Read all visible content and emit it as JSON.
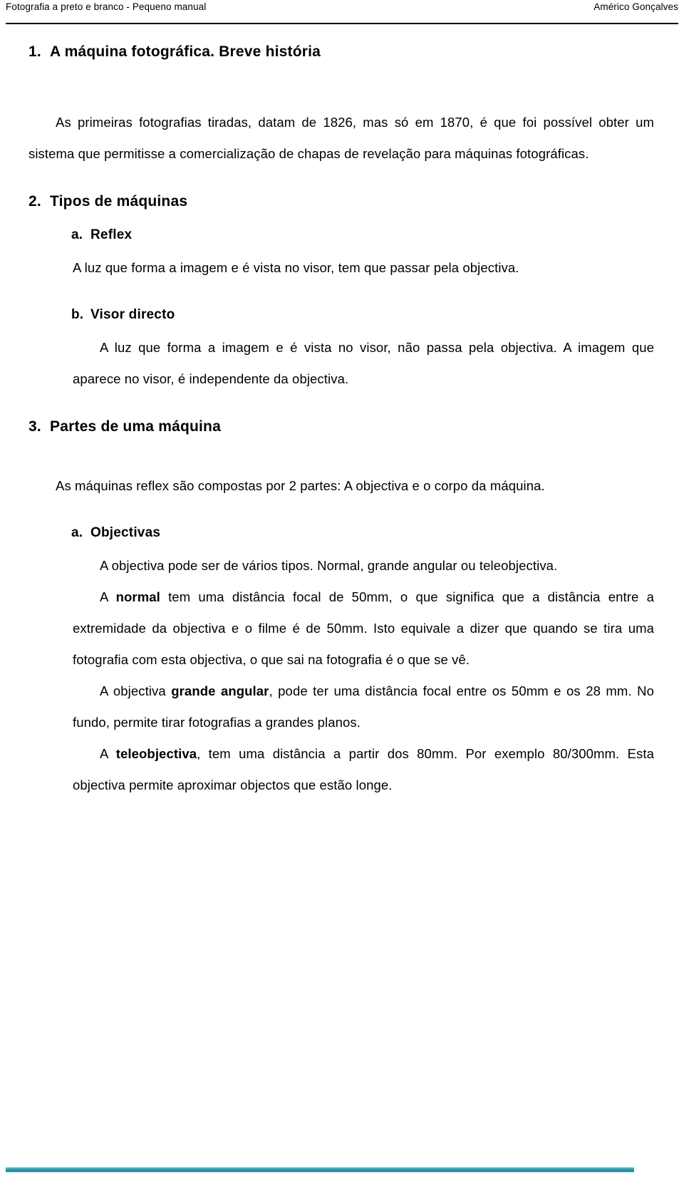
{
  "header": {
    "title": "Fotografia a preto e branco - Pequeno manual",
    "author": "Américo Gonçalves"
  },
  "sections": {
    "s1": {
      "marker": "1.",
      "title": "A máquina fotográfica. Breve história",
      "p1_lead": "As primeiras fotografias tiradas, datam de 1826, mas só em 1870, é que foi possível obter um sistema que permitisse a comercialização de chapas de revelação para máquinas fotográficas."
    },
    "s2": {
      "marker": "2.",
      "title": "Tipos de máquinas",
      "a": {
        "marker": "a.",
        "title": "Reflex",
        "body": "A luz que forma a imagem e é vista no visor, tem que passar pela objectiva."
      },
      "b": {
        "marker": "b.",
        "title": "Visor directo",
        "body": "A luz que forma a imagem e é vista no visor, não passa pela objectiva. A imagem que aparece no visor, é independente da objectiva."
      }
    },
    "s3": {
      "marker": "3.",
      "title": "Partes de uma máquina",
      "intro": "As máquinas reflex são compostas por 2 partes: A objectiva e o corpo da máquina.",
      "a": {
        "marker": "a.",
        "title": "Objectivas",
        "p1": "A objectiva pode ser de vários tipos. Normal, grande angular ou teleobjectiva.",
        "p2_pre": "A ",
        "p2_bold": "normal",
        "p2_post": " tem uma distância focal de 50mm, o que significa que a distância entre a extremidade da objectiva e o filme é de 50mm. Isto equivale a dizer que quando se tira uma fotografia com esta objectiva, o que sai na fotografia é o que se vê.",
        "p3_pre": "A objectiva ",
        "p3_bold": "grande angular",
        "p3_post": ", pode ter uma distância focal entre os 50mm e os 28 mm. No fundo, permite tirar fotografias a grandes planos.",
        "p4_pre": "A ",
        "p4_bold": "teleobjectiva",
        "p4_post": ", tem uma distância a partir dos 80mm. Por exemplo 80/300mm. Esta objectiva permite aproximar objectos que estão longe."
      }
    }
  },
  "footer": {
    "bar_color": "#2f9aa9"
  }
}
